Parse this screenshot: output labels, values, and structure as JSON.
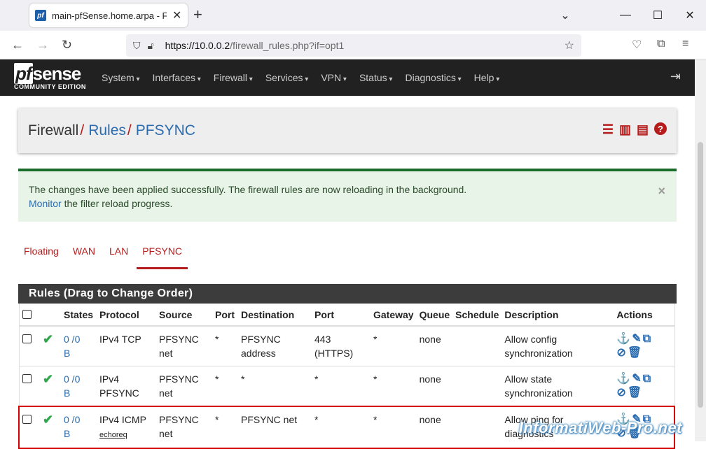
{
  "browser": {
    "tab_title": "main-pfSense.home.arpa - Fire",
    "favicon": "pf",
    "url_host": "https://10.0.0.2",
    "url_path": "/firewall_rules.php?if=opt1"
  },
  "pfsense": {
    "logo_main": "pfsense",
    "logo_pf": "pf",
    "logo_rest": "sense",
    "logo_sub": "COMMUNITY EDITION",
    "menu": [
      "System",
      "Interfaces",
      "Firewall",
      "Services",
      "VPN",
      "Status",
      "Diagnostics",
      "Help"
    ]
  },
  "breadcrumb": {
    "first": "Firewall",
    "second": "Rules",
    "third": "PFSYNC"
  },
  "alert": {
    "line1": "The changes have been applied successfully. The firewall rules are now reloading in the background.",
    "link": "Monitor",
    "line2_rest": " the filter reload progress.",
    "close": "×"
  },
  "tabs": [
    "Floating",
    "WAN",
    "LAN",
    "PFSYNC"
  ],
  "rules": {
    "title": "Rules (Drag to Change Order)",
    "columns": [
      "States",
      "Protocol",
      "Source",
      "Port",
      "Destination",
      "Port",
      "Gateway",
      "Queue",
      "Schedule",
      "Description",
      "Actions"
    ],
    "rows": [
      {
        "states": "0 /0",
        "states_b": "B",
        "protocol": "IPv4 TCP",
        "protocol_sub": "",
        "source": "PFSYNC net",
        "sport": "*",
        "dest": "PFSYNC address",
        "dport": "443 (HTTPS)",
        "gateway": "*",
        "queue": "none",
        "schedule": "",
        "description": "Allow config synchronization"
      },
      {
        "states": "0 /0",
        "states_b": "B",
        "protocol": "IPv4 PFSYNC",
        "protocol_sub": "",
        "source": "PFSYNC net",
        "sport": "*",
        "dest": "*",
        "dport": "*",
        "gateway": "*",
        "queue": "none",
        "schedule": "",
        "description": "Allow state synchronization"
      },
      {
        "states": "0 /0",
        "states_b": "B",
        "protocol": "IPv4 ICMP",
        "protocol_sub": "echoreq",
        "source": "PFSYNC net",
        "sport": "*",
        "dest": "PFSYNC net",
        "dport": "*",
        "gateway": "*",
        "queue": "none",
        "schedule": "",
        "description": "Allow ping for diagnostics"
      }
    ]
  },
  "watermark": "InformatiWeb-Pro.net",
  "colors": {
    "accent_red": "#b71c1c",
    "link_blue": "#2b6cb0",
    "nav_dark": "#212121",
    "success_green": "#2ea84a"
  }
}
